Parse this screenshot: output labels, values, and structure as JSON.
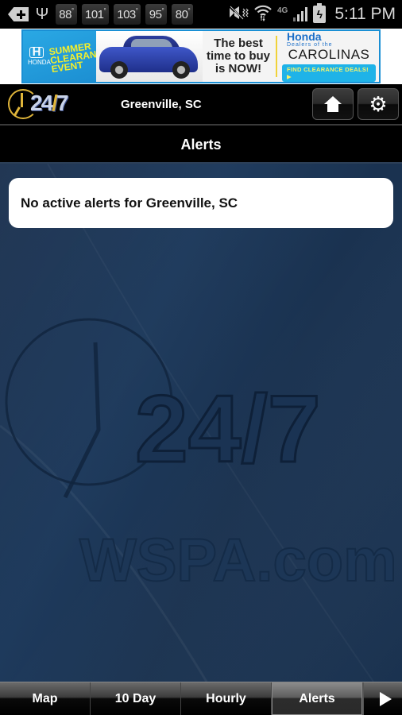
{
  "status_bar": {
    "temperatures": [
      "88",
      "101",
      "103",
      "95",
      "80"
    ],
    "degree_symbol": "°",
    "usb_glyph": "Ψ",
    "mute_glyph": "🔇",
    "wifi_glyph": "◠",
    "network_label": "4G",
    "battery_glyph": "ϟ",
    "time": "5:11 PM"
  },
  "ad": {
    "brand_short": "H",
    "brand_name": "HONDA",
    "promo_lines": [
      "Summer",
      "Clearance",
      "Event"
    ],
    "tagline_lines": [
      "The best",
      "time to buy",
      "is NOW!"
    ],
    "dealer_brand": "Honda",
    "dealer_sub": "Dealers of the",
    "dealer_name": "CAROLINAS",
    "cta": "FIND CLEARANCE DEALS! ▶"
  },
  "header": {
    "logo_text_a": "24",
    "logo_slash": "/",
    "logo_text_b": "7",
    "location": "Greenville, SC",
    "home_label": "Home",
    "settings_glyph": "⚙"
  },
  "page": {
    "title": "Alerts"
  },
  "alerts": {
    "message": "No active alerts for Greenville, SC"
  },
  "watermark": {
    "logo": "24/7",
    "site": "WSPA.com"
  },
  "tabs": [
    {
      "label": "Map",
      "active": false
    },
    {
      "label": "10 Day",
      "active": false
    },
    {
      "label": "Hourly",
      "active": false
    },
    {
      "label": "Alerts",
      "active": true
    }
  ],
  "colors": {
    "background_blue": "#1e3a5c",
    "logo_gold": "#e0b53a",
    "ad_blue": "#1a8fd4"
  }
}
